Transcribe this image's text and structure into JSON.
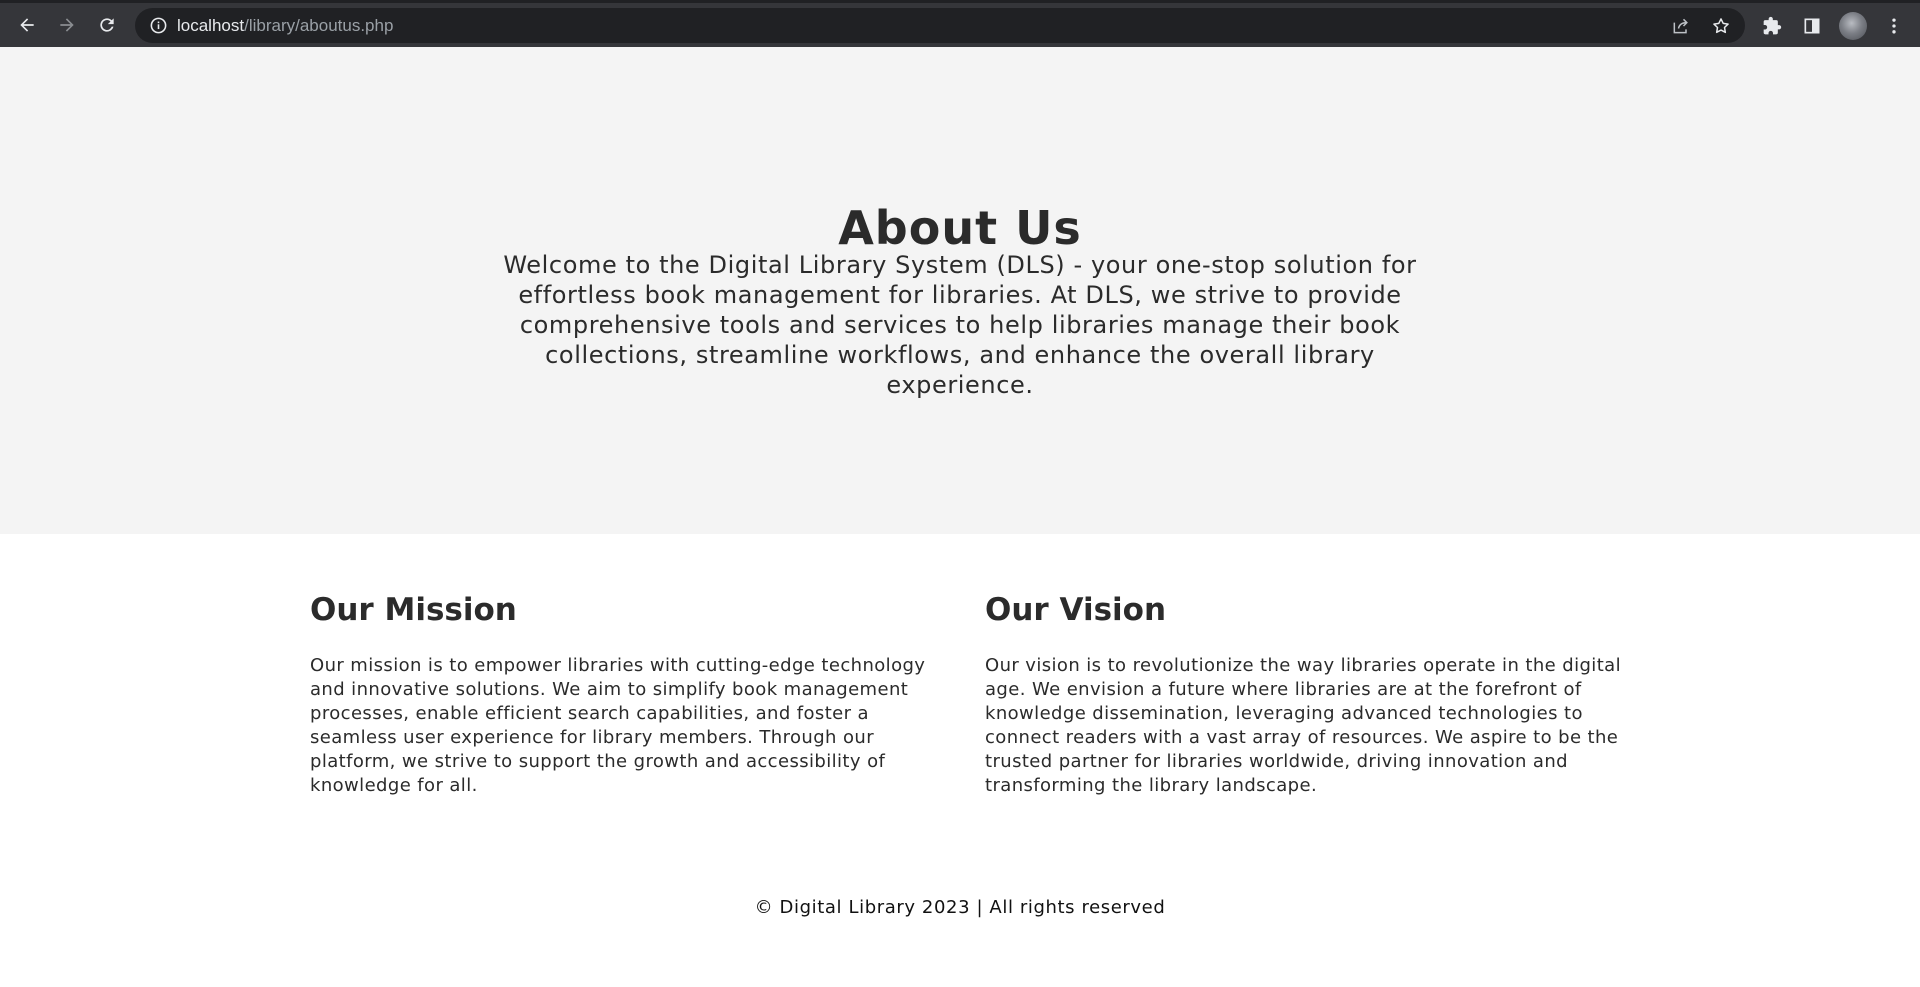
{
  "browser": {
    "url_host": "localhost",
    "url_path": "/library/aboutus.php"
  },
  "hero": {
    "title": "About Us",
    "text": "Welcome to the Digital Library System (DLS) - your one-stop solution for effortless book management for libraries. At DLS, we strive to provide comprehensive tools and services to help libraries manage their book collections, streamline workflows, and enhance the overall library experience."
  },
  "mission": {
    "heading": "Our Mission",
    "text": "Our mission is to empower libraries with cutting-edge technology and innovative solutions. We aim to simplify book management processes, enable efficient search capabilities, and foster a seamless user experience for library members. Through our platform, we strive to support the growth and accessibility of knowledge for all."
  },
  "vision": {
    "heading": "Our Vision",
    "text": "Our vision is to revolutionize the way libraries operate in the digital age. We envision a future where libraries are at the forefront of knowledge dissemination, leveraging advanced technologies to connect readers with a vast array of resources. We aspire to be the trusted partner for libraries worldwide, driving innovation and transforming the library landscape."
  },
  "footer": {
    "text": "© Digital Library 2023 | All rights reserved"
  }
}
